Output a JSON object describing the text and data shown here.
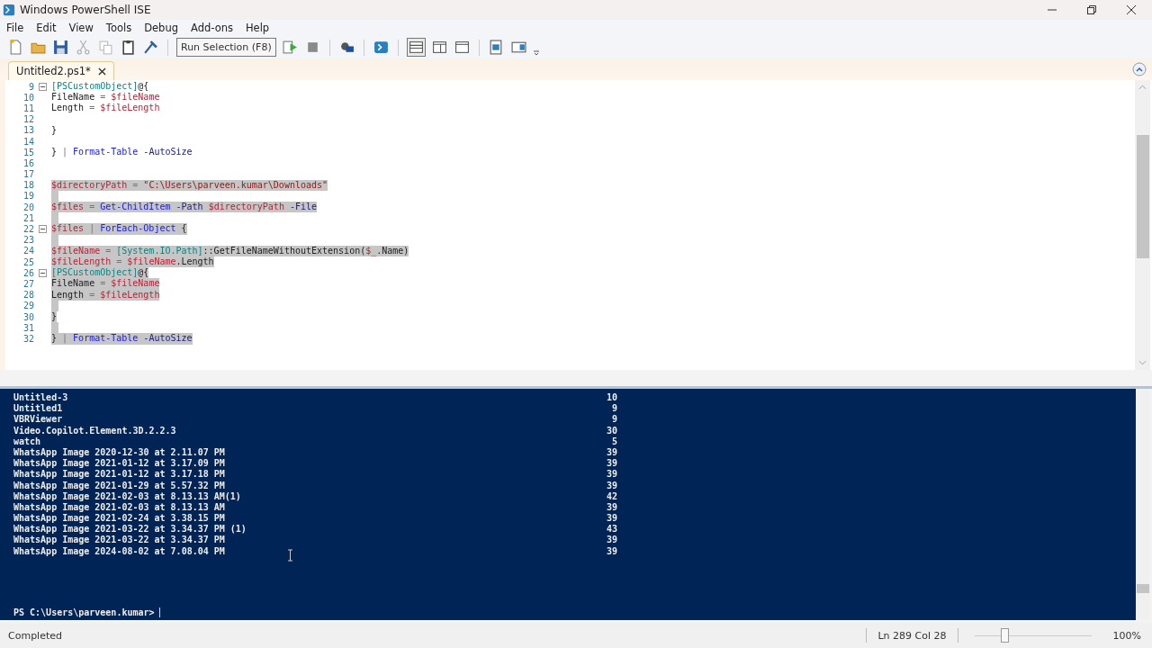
{
  "window": {
    "title": "Windows PowerShell ISE"
  },
  "menu": [
    "File",
    "Edit",
    "View",
    "Tools",
    "Debug",
    "Add-ons",
    "Help"
  ],
  "toolbar": {
    "tooltip": "Run Selection (F8)"
  },
  "tabs": [
    {
      "label": "Untitled2.ps1*",
      "selected": true
    }
  ],
  "editor": {
    "lines": [
      {
        "num": "9",
        "fold": true,
        "selected": false,
        "tokens": [
          {
            "text": "[PSCustomObject]",
            "kind": "type"
          },
          {
            "text": "@{",
            "kind": "plain"
          }
        ]
      },
      {
        "num": "10",
        "fold": false,
        "selected": false,
        "tokens": [
          {
            "text": "FileName",
            "kind": "plain"
          },
          {
            "text": " = ",
            "kind": "op"
          },
          {
            "text": "$fileName",
            "kind": "var"
          }
        ]
      },
      {
        "num": "11",
        "fold": false,
        "selected": false,
        "tokens": [
          {
            "text": "Length",
            "kind": "plain"
          },
          {
            "text": " = ",
            "kind": "op"
          },
          {
            "text": "$fileLength",
            "kind": "var"
          }
        ]
      },
      {
        "num": "12",
        "fold": false,
        "selected": false
      },
      {
        "num": "13",
        "fold": false,
        "selected": false,
        "tokens": [
          {
            "text": "}",
            "kind": "plain"
          }
        ]
      },
      {
        "num": "14",
        "fold": false,
        "selected": false
      },
      {
        "num": "15",
        "fold": false,
        "selected": false,
        "tokens": [
          {
            "text": "}",
            "kind": "plain"
          },
          {
            "text": " | ",
            "kind": "op"
          },
          {
            "text": "Format-Table",
            "kind": "cmd"
          },
          {
            "text": " -AutoSize",
            "kind": "param"
          }
        ]
      },
      {
        "num": "16",
        "fold": false,
        "selected": false
      },
      {
        "num": "17",
        "fold": false,
        "selected": false
      },
      {
        "num": "18",
        "fold": false,
        "selected": true,
        "tokens": [
          {
            "text": "$directoryPath",
            "kind": "var"
          },
          {
            "text": " = ",
            "kind": "op"
          },
          {
            "text": "\"C:\\Users\\parveen.kumar\\Downloads\"",
            "kind": "string"
          }
        ]
      },
      {
        "num": "19",
        "fold": false,
        "selected": true
      },
      {
        "num": "20",
        "fold": false,
        "selected": true,
        "tokens": [
          {
            "text": "$files",
            "kind": "var"
          },
          {
            "text": " = ",
            "kind": "op"
          },
          {
            "text": "Get-ChildItem",
            "kind": "cmd"
          },
          {
            "text": " -Path ",
            "kind": "param"
          },
          {
            "text": "$directoryPath",
            "kind": "var"
          },
          {
            "text": " -File",
            "kind": "param"
          }
        ]
      },
      {
        "num": "21",
        "fold": false,
        "selected": true
      },
      {
        "num": "22",
        "fold": true,
        "selected": true,
        "tokens": [
          {
            "text": "$files",
            "kind": "var"
          },
          {
            "text": " | ",
            "kind": "op"
          },
          {
            "text": "ForEach-Object",
            "kind": "cmd"
          },
          {
            "text": " {",
            "kind": "plain"
          }
        ]
      },
      {
        "num": "23",
        "fold": false,
        "selected": true
      },
      {
        "num": "24",
        "fold": false,
        "selected": true,
        "tokens": [
          {
            "text": "$fileName",
            "kind": "var"
          },
          {
            "text": " = ",
            "kind": "op"
          },
          {
            "text": "[System.IO.Path]",
            "kind": "type"
          },
          {
            "text": "::GetFileNameWithoutExtension(",
            "kind": "plain"
          },
          {
            "text": "$_",
            "kind": "var"
          },
          {
            "text": ".Name)",
            "kind": "plain"
          }
        ]
      },
      {
        "num": "25",
        "fold": false,
        "selected": true,
        "tokens": [
          {
            "text": "$fileLength",
            "kind": "var"
          },
          {
            "text": " = ",
            "kind": "op"
          },
          {
            "text": "$fileName",
            "kind": "var"
          },
          {
            "text": ".Length",
            "kind": "plain"
          }
        ]
      },
      {
        "num": "26",
        "fold": true,
        "selected": true,
        "tokens": [
          {
            "text": "[PSCustomObject]",
            "kind": "type"
          },
          {
            "text": "@{",
            "kind": "plain"
          }
        ]
      },
      {
        "num": "27",
        "fold": false,
        "selected": true,
        "tokens": [
          {
            "text": "FileName",
            "kind": "plain"
          },
          {
            "text": " = ",
            "kind": "op"
          },
          {
            "text": "$fileName",
            "kind": "var"
          }
        ]
      },
      {
        "num": "28",
        "fold": false,
        "selected": true,
        "tokens": [
          {
            "text": "Length",
            "kind": "plain"
          },
          {
            "text": " = ",
            "kind": "op"
          },
          {
            "text": "$fileLength",
            "kind": "var"
          }
        ]
      },
      {
        "num": "29",
        "fold": false,
        "selected": true
      },
      {
        "num": "30",
        "fold": false,
        "selected": true,
        "tokens": [
          {
            "text": "}",
            "kind": "plain"
          }
        ]
      },
      {
        "num": "31",
        "fold": false,
        "selected": true
      },
      {
        "num": "32",
        "fold": false,
        "selected": true,
        "tokens": [
          {
            "text": "}",
            "kind": "plain"
          },
          {
            "text": " | ",
            "kind": "op"
          },
          {
            "text": "Format-Table",
            "kind": "cmd"
          },
          {
            "text": " -AutoSize",
            "kind": "param"
          }
        ]
      }
    ]
  },
  "console": {
    "rows": [
      {
        "name": "Untitled-3",
        "length": "10"
      },
      {
        "name": "Untitled1",
        "length": "9"
      },
      {
        "name": "VBRViewer",
        "length": "9"
      },
      {
        "name": "Video.Copilot.Element.3D.2.2.3",
        "length": "30"
      },
      {
        "name": "watch",
        "length": "5"
      },
      {
        "name": "WhatsApp Image 2020-12-30 at 2.11.07 PM",
        "length": "39"
      },
      {
        "name": "WhatsApp Image 2021-01-12 at 3.17.09 PM",
        "length": "39"
      },
      {
        "name": "WhatsApp Image 2021-01-12 at 3.17.18 PM",
        "length": "39"
      },
      {
        "name": "WhatsApp Image 2021-01-29 at 5.57.32 PM",
        "length": "39"
      },
      {
        "name": "WhatsApp Image 2021-02-03 at 8.13.13 AM(1)",
        "length": "42"
      },
      {
        "name": "WhatsApp Image 2021-02-03 at 8.13.13 AM",
        "length": "39"
      },
      {
        "name": "WhatsApp Image 2021-02-24 at 3.38.15 PM",
        "length": "39"
      },
      {
        "name": "WhatsApp Image 2021-03-22 at 3.34.37 PM (1)",
        "length": "43"
      },
      {
        "name": "WhatsApp Image 2021-03-22 at 3.34.37 PM",
        "length": "39"
      },
      {
        "name": "WhatsApp Image 2024-08-02 at 7.08.04 PM",
        "length": "39"
      }
    ],
    "prompt": "PS C:\\Users\\parveen.kumar>"
  },
  "status_bar": {
    "status": "Completed",
    "position": "Ln 289  Col 28",
    "zoom": {
      "level": 0.25,
      "reading": "100%"
    }
  }
}
